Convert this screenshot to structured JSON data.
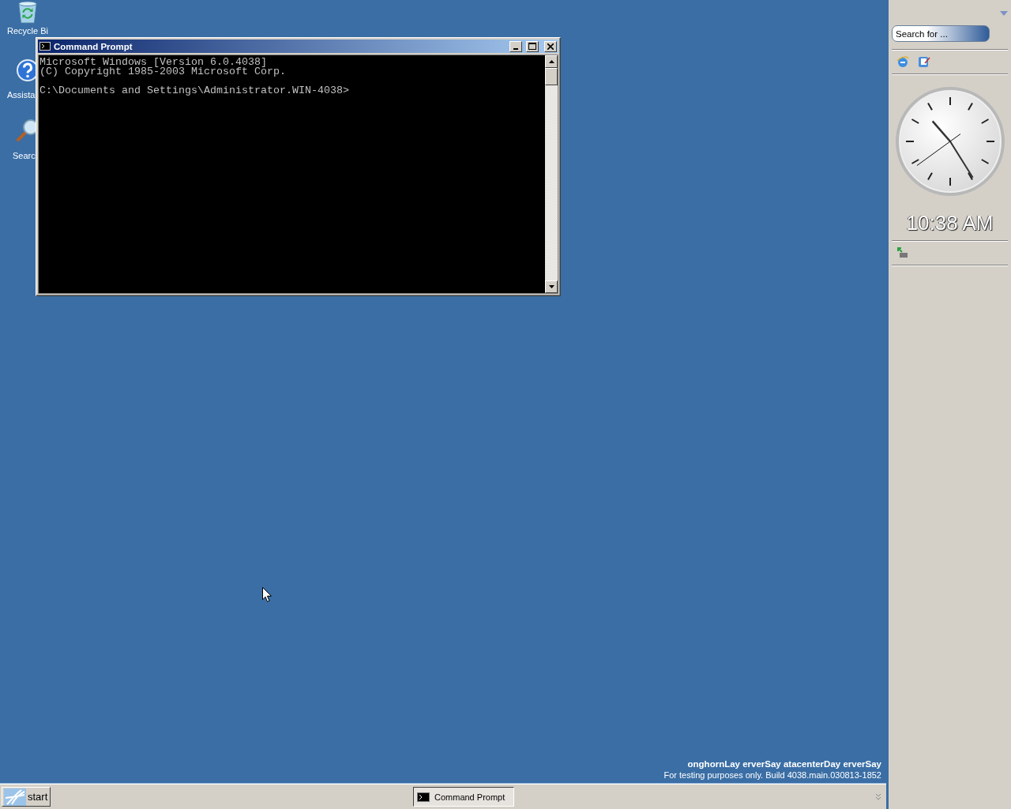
{
  "desktop_icons": [
    {
      "kind": "recycle",
      "label": "Recycle Bi"
    },
    {
      "kind": "help",
      "label": "Assista"
    },
    {
      "kind": "search",
      "label": "Searc"
    }
  ],
  "window": {
    "title": "Command Prompt",
    "output": [
      "Microsoft Windows [Version 6.0.4038]",
      "(C) Copyright 1985-2003 Microsoft Corp."
    ],
    "prompt": "C:\\Documents and Settings\\Administrator.WIN-4038>"
  },
  "build_info": {
    "title": "onghornLay erverSay atacenterDay erverSay",
    "build": "For testing purposes only. Build 4038.main.030813-1852"
  },
  "taskbar": {
    "start": "start",
    "tasks": [
      {
        "label": "Command Prompt",
        "selected": true
      }
    ]
  },
  "sidebar": {
    "search": {
      "placeholder": "Search for ..."
    },
    "clock": {
      "time": "10:38 AM"
    }
  }
}
